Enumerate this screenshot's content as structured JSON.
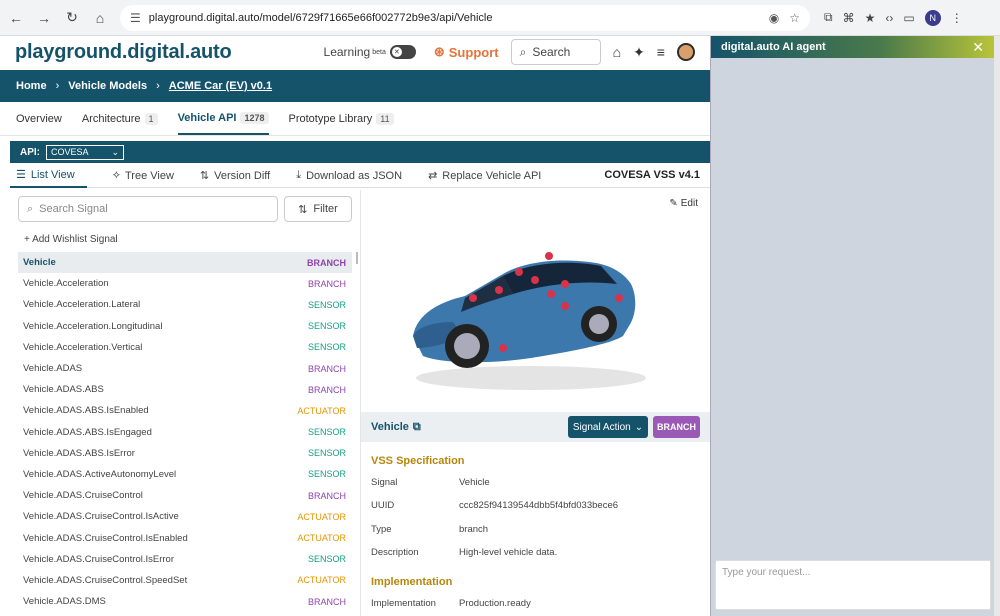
{
  "browser": {
    "url": "playground.digital.auto/model/6729f71665e66f002772b9e3/api/Vehicle",
    "profile_initial": "N"
  },
  "header": {
    "logo": "playground.digital.auto",
    "learning_label": "Learning",
    "learning_sup": "beta",
    "support_label": "Support",
    "search_label": "Search"
  },
  "breadcrumb": {
    "home": "Home",
    "models": "Vehicle Models",
    "current": "ACME Car (EV) v0.1"
  },
  "tabs": [
    {
      "label": "Overview",
      "badge": ""
    },
    {
      "label": "Architecture",
      "badge": "1"
    },
    {
      "label": "Vehicle API",
      "badge": "1278"
    },
    {
      "label": "Prototype Library",
      "badge": "11"
    }
  ],
  "api": {
    "label": "API:",
    "selected": "COVESA"
  },
  "views": {
    "list": "List View",
    "tree": "Tree View",
    "diff": "Version Diff",
    "download": "Download as JSON",
    "replace": "Replace Vehicle API",
    "version": "COVESA VSS v4.1"
  },
  "signal_search": {
    "placeholder": "Search Signal",
    "filter_label": "Filter",
    "wishlist_label": "+ Add Wishlist Signal"
  },
  "signals": [
    {
      "name": "Vehicle",
      "type": "BRANCH"
    },
    {
      "name": "Vehicle.Acceleration",
      "type": "BRANCH"
    },
    {
      "name": "Vehicle.Acceleration.Lateral",
      "type": "SENSOR"
    },
    {
      "name": "Vehicle.Acceleration.Longitudinal",
      "type": "SENSOR"
    },
    {
      "name": "Vehicle.Acceleration.Vertical",
      "type": "SENSOR"
    },
    {
      "name": "Vehicle.ADAS",
      "type": "BRANCH"
    },
    {
      "name": "Vehicle.ADAS.ABS",
      "type": "BRANCH"
    },
    {
      "name": "Vehicle.ADAS.ABS.IsEnabled",
      "type": "ACTUATOR"
    },
    {
      "name": "Vehicle.ADAS.ABS.IsEngaged",
      "type": "SENSOR"
    },
    {
      "name": "Vehicle.ADAS.ABS.IsError",
      "type": "SENSOR"
    },
    {
      "name": "Vehicle.ADAS.ActiveAutonomyLevel",
      "type": "SENSOR"
    },
    {
      "name": "Vehicle.ADAS.CruiseControl",
      "type": "BRANCH"
    },
    {
      "name": "Vehicle.ADAS.CruiseControl.IsActive",
      "type": "ACTUATOR"
    },
    {
      "name": "Vehicle.ADAS.CruiseControl.IsEnabled",
      "type": "ACTUATOR"
    },
    {
      "name": "Vehicle.ADAS.CruiseControl.IsError",
      "type": "SENSOR"
    },
    {
      "name": "Vehicle.ADAS.CruiseControl.SpeedSet",
      "type": "ACTUATOR"
    },
    {
      "name": "Vehicle.ADAS.DMS",
      "type": "BRANCH"
    }
  ],
  "detail": {
    "edit_label": "Edit",
    "name": "Vehicle",
    "action_label": "Signal Action",
    "type_badge": "BRANCH",
    "spec_title": "VSS Specification",
    "spec": [
      {
        "key": "Signal",
        "value": "Vehicle"
      },
      {
        "key": "UUID",
        "value": "ccc825f94139544dbb5f4bfd033bece6"
      },
      {
        "key": "Type",
        "value": "branch"
      },
      {
        "key": "Description",
        "value": "High-level vehicle data."
      }
    ],
    "impl_title": "Implementation",
    "impl": [
      {
        "key": "Implementation",
        "value": "Production.ready"
      }
    ]
  },
  "ai_agent": {
    "title": "digital.auto AI agent",
    "placeholder": "Type your request..."
  },
  "colors": {
    "primary": "#15536b",
    "branch": "#8e44ad",
    "sensor": "#16a085",
    "actuator": "#e69500",
    "support": "#e8733a",
    "car_body": "#3d78ad",
    "pin": "#d9334a"
  }
}
